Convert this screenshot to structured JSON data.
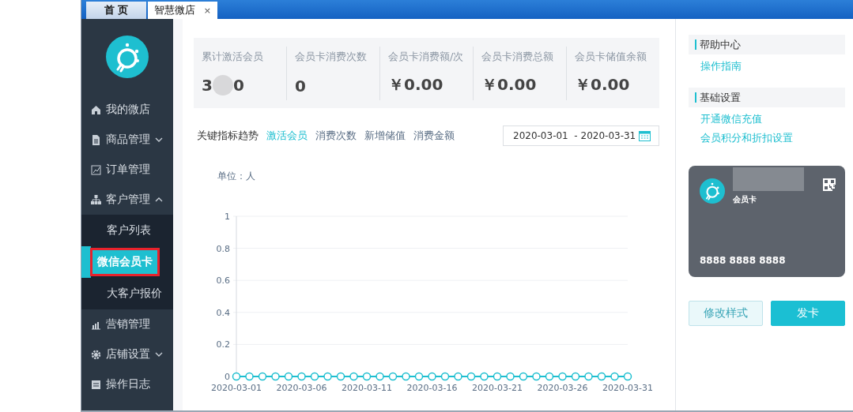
{
  "tabs": [
    {
      "label": "首 页",
      "selected": false
    },
    {
      "label": "智慧微店",
      "selected": true,
      "close": "×"
    }
  ],
  "sidebar": {
    "items": [
      {
        "label": "我的微店"
      },
      {
        "label": "商品管理",
        "expanded": false
      },
      {
        "label": "订单管理"
      },
      {
        "label": "客户管理",
        "expanded": true,
        "children": [
          {
            "label": "客户列表",
            "selected": false
          },
          {
            "label": "微信会员卡",
            "selected": true
          },
          {
            "label": "大客户报价",
            "selected": false
          }
        ]
      },
      {
        "label": "营销管理"
      },
      {
        "label": "店铺设置",
        "expanded": false
      },
      {
        "label": "操作日志"
      }
    ]
  },
  "stats": [
    {
      "label": "累计激活会员",
      "value_parts": [
        "3",
        "0"
      ]
    },
    {
      "label": "会员卡消费次数",
      "value_parts": [
        "0"
      ]
    },
    {
      "label": "会员卡消费额/次",
      "value_parts": [
        "￥0.00"
      ]
    },
    {
      "label": "会员卡消费总额",
      "value_parts": [
        "￥0.00"
      ]
    },
    {
      "label": "会员卡储值余额",
      "value_parts": [
        "￥0.00"
      ]
    }
  ],
  "trend": {
    "title": "关键指标趋势",
    "metrics": [
      {
        "label": "激活会员",
        "selected": true
      },
      {
        "label": "消费次数",
        "selected": false
      },
      {
        "label": "新增储值",
        "selected": false
      },
      {
        "label": "消费金额",
        "selected": false
      }
    ],
    "date_range": "2020-03-01  - 2020-03-31",
    "unit": "单位：人",
    "chart_data": {
      "type": "line",
      "grid": true,
      "categories": [
        "2020-03-01",
        null,
        null,
        null,
        null,
        "2020-03-06",
        null,
        null,
        null,
        null,
        "2020-03-11",
        null,
        null,
        null,
        null,
        "2020-03-16",
        null,
        null,
        null,
        null,
        "2020-03-21",
        null,
        null,
        null,
        null,
        "2020-03-26",
        null,
        null,
        null,
        null,
        "2020-03-31"
      ],
      "series": [
        {
          "color": "#1ebfd0",
          "marker": "circle",
          "values": [
            0,
            0,
            0,
            0,
            0,
            0,
            0,
            0,
            0,
            0,
            0,
            0,
            0,
            0,
            0,
            0,
            0,
            0,
            0,
            0,
            0,
            0,
            0,
            0,
            0,
            0,
            0,
            0,
            0,
            0,
            0
          ]
        }
      ],
      "ylim": [
        0,
        1
      ],
      "yticks": [
        0,
        0.2,
        0.4,
        0.6,
        0.8,
        1
      ]
    }
  },
  "help": {
    "sections": [
      {
        "title": "帮助中心",
        "links": [
          "操作指南"
        ]
      },
      {
        "title": "基础设置",
        "links": [
          "开通微信充值",
          "会员积分和折扣设置"
        ]
      }
    ]
  },
  "card": {
    "name_blurred": true,
    "subtitle": "会员卡",
    "number": "8888 8888 8888"
  },
  "buttons": [
    {
      "label": "修改样式",
      "kind": "secondary"
    },
    {
      "label": "发卡",
      "kind": "primary"
    }
  ]
}
